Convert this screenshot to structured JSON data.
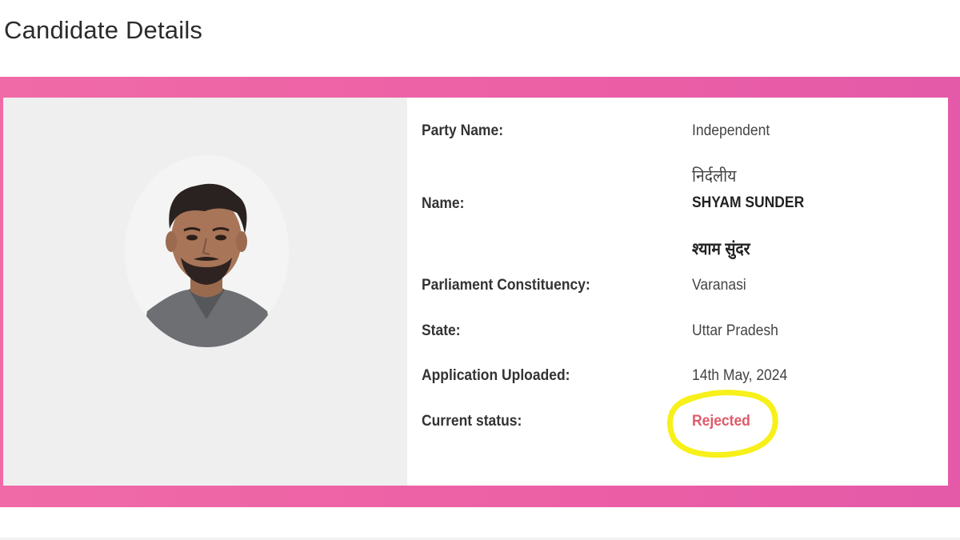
{
  "page": {
    "title": "Candidate Details"
  },
  "candidate": {
    "party_label": "Party Name:",
    "party_value": "Independent",
    "party_value_hindi": "निर्दलीय",
    "name_label": "Name:",
    "name_value": "SHYAM SUNDER",
    "name_value_hindi": "श्याम सुंदर",
    "constituency_label": "Parliament Constituency:",
    "constituency_value": "Varanasi",
    "state_label": "State:",
    "state_value": "Uttar Pradesh",
    "uploaded_label": "Application Uploaded:",
    "uploaded_value": "14th May, 2024",
    "status_label": "Current status:",
    "status_value": "Rejected"
  },
  "colors": {
    "frame_pink": "#ec5fa6",
    "status_red": "#e05a6a",
    "highlight_yellow": "#f7f01a",
    "photo_panel_bg": "#efefef"
  }
}
